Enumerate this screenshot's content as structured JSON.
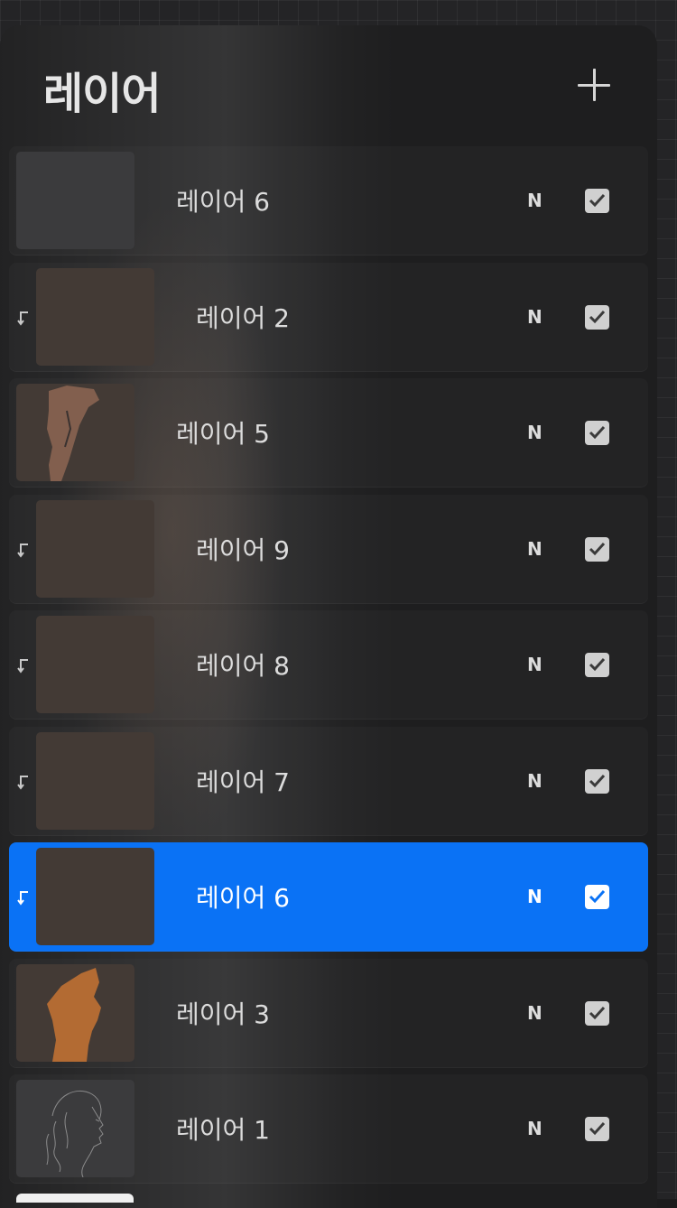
{
  "panel": {
    "title": "레이어",
    "add_icon": "plus-icon"
  },
  "layers": [
    {
      "name": "레이어 6",
      "blend": "N",
      "visible": true,
      "clipped": false,
      "selected": false,
      "thumb": "gray"
    },
    {
      "name": "레이어 2",
      "blend": "N",
      "visible": true,
      "clipped": true,
      "selected": false,
      "thumb": "brown"
    },
    {
      "name": "레이어 5",
      "blend": "N",
      "visible": true,
      "clipped": false,
      "selected": false,
      "thumb": "silhouette-outline"
    },
    {
      "name": "레이어 9",
      "blend": "N",
      "visible": true,
      "clipped": true,
      "selected": false,
      "thumb": "brown"
    },
    {
      "name": "레이어 8",
      "blend": "N",
      "visible": true,
      "clipped": true,
      "selected": false,
      "thumb": "brown"
    },
    {
      "name": "레이어 7",
      "blend": "N",
      "visible": true,
      "clipped": true,
      "selected": false,
      "thumb": "brown"
    },
    {
      "name": "레이어 6",
      "blend": "N",
      "visible": true,
      "clipped": true,
      "selected": true,
      "thumb": "brown"
    },
    {
      "name": "레이어 3",
      "blend": "N",
      "visible": true,
      "clipped": false,
      "selected": false,
      "thumb": "silhouette-orange"
    },
    {
      "name": "레이어 1",
      "blend": "N",
      "visible": true,
      "clipped": false,
      "selected": false,
      "thumb": "line-sketch"
    }
  ],
  "colors": {
    "selected": "#0a72f5",
    "panel_bg": "#1e1e1f",
    "silhouette_orange": "#b36b33",
    "silhouette_outline": "#8a6451"
  }
}
